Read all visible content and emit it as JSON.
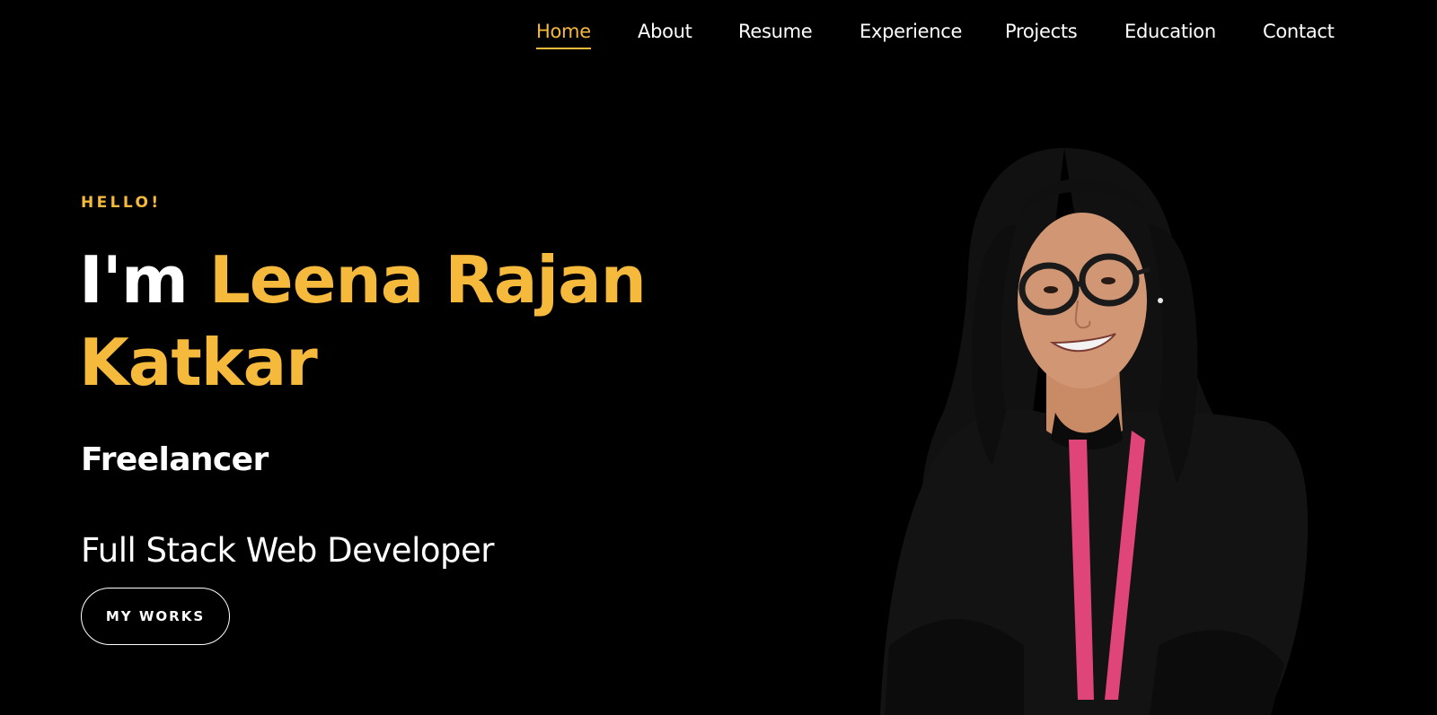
{
  "nav": {
    "items": [
      {
        "label": "Home",
        "active": true
      },
      {
        "label": "About",
        "active": false
      },
      {
        "label": "Resume",
        "active": false
      },
      {
        "label": "Experience",
        "active": false
      },
      {
        "label": "Projects",
        "active": false
      },
      {
        "label": "Education",
        "active": false
      },
      {
        "label": "Contact",
        "active": false
      }
    ]
  },
  "hero": {
    "greeting": "HELLO!",
    "name_prefix": "I'm ",
    "name_highlight": "Leena Rajan Katkar",
    "role": "Freelancer",
    "subtitle": "Full Stack Web Developer",
    "cta_label": "MY WORKS"
  },
  "colors": {
    "background": "#000000",
    "accent": "#f5b93b",
    "text": "#ffffff",
    "lanyard": "#e0457a"
  },
  "image": {
    "subject": "portrait-photo"
  }
}
